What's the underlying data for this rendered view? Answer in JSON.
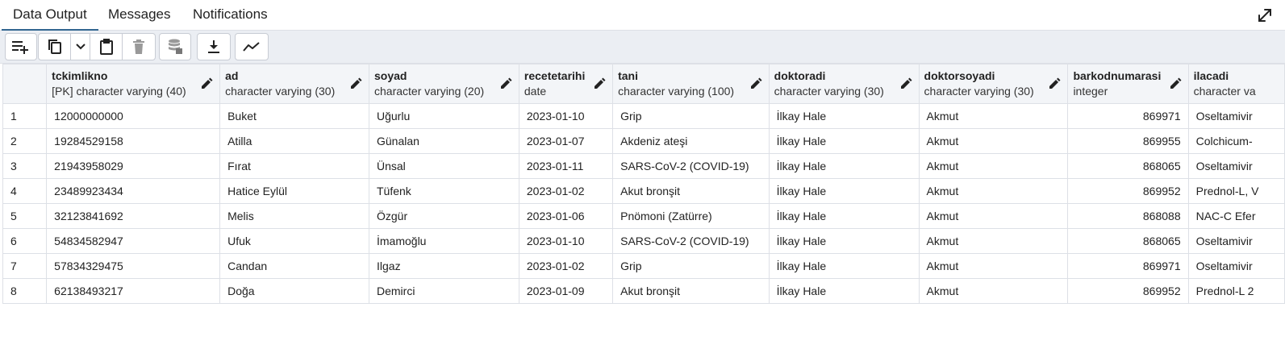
{
  "tabs": [
    {
      "label": "Data Output",
      "active": true
    },
    {
      "label": "Messages",
      "active": false
    },
    {
      "label": "Notifications",
      "active": false
    }
  ],
  "toolbar": {
    "add_row_icon": "add-row-icon",
    "copy_icon": "copy-icon",
    "copy_options_icon": "chevron-down-icon",
    "paste_icon": "paste-icon",
    "delete_icon": "trash-icon",
    "save_data_icon": "database-save-icon",
    "download_icon": "download-icon",
    "graph_icon": "graph-icon"
  },
  "accent_color": "#326690",
  "table": {
    "columns": [
      {
        "name": "tckimlikno",
        "type": "[PK] character varying (40)"
      },
      {
        "name": "ad",
        "type": "character varying (30)"
      },
      {
        "name": "soyad",
        "type": "character varying (20)"
      },
      {
        "name": "recetetarihi",
        "type": "date"
      },
      {
        "name": "tani",
        "type": "character varying (100)"
      },
      {
        "name": "doktoradi",
        "type": "character varying (30)"
      },
      {
        "name": "doktorsoyadi",
        "type": "character varying (30)"
      },
      {
        "name": "barkodnumarasi",
        "type": "integer"
      },
      {
        "name": "ilacadi",
        "type": "character va"
      }
    ],
    "rows": [
      {
        "num": "1",
        "cells": [
          "12000000000",
          "Buket",
          "Uğurlu",
          "2023-01-10",
          "Grip",
          "İlkay Hale",
          "Akmut",
          "869971",
          "Oseltamivir"
        ]
      },
      {
        "num": "2",
        "cells": [
          "19284529158",
          "Atilla",
          "Günalan",
          "2023-01-07",
          "Akdeniz ateşi",
          "İlkay Hale",
          "Akmut",
          "869955",
          "Colchicum-"
        ]
      },
      {
        "num": "3",
        "cells": [
          "21943958029",
          "Fırat",
          "Ünsal",
          "2023-01-11",
          "SARS-CoV-2 (COVID-19)",
          "İlkay Hale",
          "Akmut",
          "868065",
          "Oseltamivir"
        ]
      },
      {
        "num": "4",
        "cells": [
          "23489923434",
          "Hatice Eylül",
          "Tüfenk",
          "2023-01-02",
          "Akut bronşit",
          "İlkay Hale",
          "Akmut",
          "869952",
          "Prednol-L, V"
        ]
      },
      {
        "num": "5",
        "cells": [
          "32123841692",
          "Melis",
          "Özgür",
          "2023-01-06",
          "Pnömoni (Zatürre)",
          "İlkay Hale",
          "Akmut",
          "868088",
          "NAC-C Efer"
        ]
      },
      {
        "num": "6",
        "cells": [
          "54834582947",
          "Ufuk",
          "İmamoğlu",
          "2023-01-10",
          "SARS-CoV-2 (COVID-19)",
          "İlkay Hale",
          "Akmut",
          "868065",
          "Oseltamivir"
        ]
      },
      {
        "num": "7",
        "cells": [
          "57834329475",
          "Candan",
          "Ilgaz",
          "2023-01-02",
          "Grip",
          "İlkay Hale",
          "Akmut",
          "869971",
          "Oseltamivir"
        ]
      },
      {
        "num": "8",
        "cells": [
          "62138493217",
          "Doğa",
          "Demirci",
          "2023-01-09",
          "Akut bronşit",
          "İlkay Hale",
          "Akmut",
          "869952",
          "Prednol-L 2"
        ]
      }
    ]
  }
}
